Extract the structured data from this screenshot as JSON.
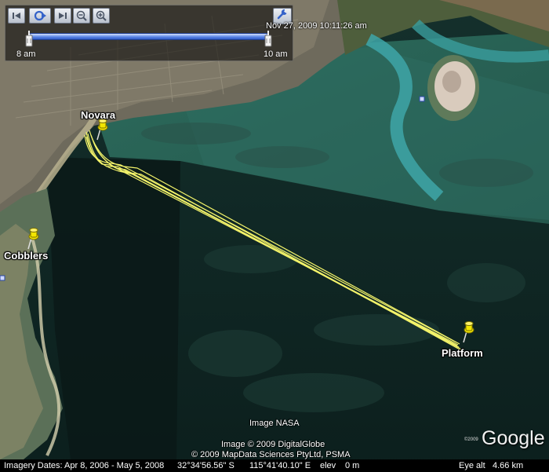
{
  "time_slider": {
    "start_label": "8 am",
    "end_label": "10 am",
    "timestamp": "Nov 27, 2009  10:11:26 am"
  },
  "placemarks": [
    {
      "name": "Novara"
    },
    {
      "name": "Cobblers"
    },
    {
      "name": "Platform"
    }
  ],
  "track_color": "#f3f36a",
  "pin_color": "#f2e600",
  "attribution": {
    "image_nasa": "Image NASA",
    "image_digitalglobe": "Image © 2009 DigitalGlobe",
    "mapdata": "© 2009 MapData Sciences PtyLtd, PSMA",
    "copyright_small": "©2009",
    "logo": "Google"
  },
  "status_bar": {
    "imagery_dates": "Imagery Dates: Apr 8, 2006 - May 5, 2008",
    "lat": "32°34'56.56\" S",
    "lon": "115°41'40.10\" E",
    "elev_label": "elev",
    "elev_value": "0 m",
    "eye_alt_label": "Eye alt",
    "eye_alt_value": "4.66 km"
  },
  "icons": [
    "skip-back-icon",
    "play-loop-icon",
    "skip-forward-icon",
    "zoom-out-icon",
    "zoom-in-icon",
    "wrench-icon",
    "placemark-pushpin-icon"
  ]
}
